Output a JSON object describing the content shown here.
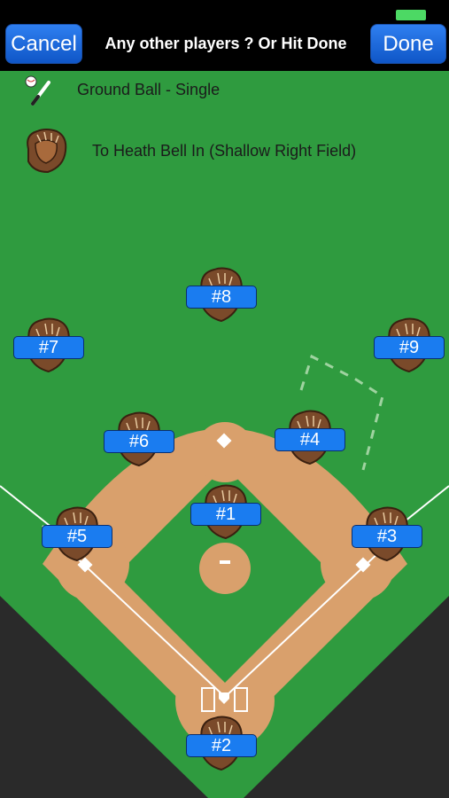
{
  "nav": {
    "cancel_label": "Cancel",
    "title": "Any other players ? Or Hit Done",
    "done_label": "Done"
  },
  "play": {
    "type_text": "Ground Ball - Single",
    "fielder_text": "To Heath Bell In (Shallow Right Field)"
  },
  "positions": {
    "p8": "#8",
    "p7": "#7",
    "p9": "#9",
    "p6": "#6",
    "p4": "#4",
    "p1": "#1",
    "p5": "#5",
    "p3": "#3",
    "p2": "#2"
  },
  "colors": {
    "grass": "#2f9b3f",
    "dirt": "#d9a06c",
    "button_blue": "#1a7cf0",
    "glove_brown": "#7a4a2a"
  },
  "icons": {
    "bat": "bat-ball-icon",
    "glove": "glove-icon"
  }
}
